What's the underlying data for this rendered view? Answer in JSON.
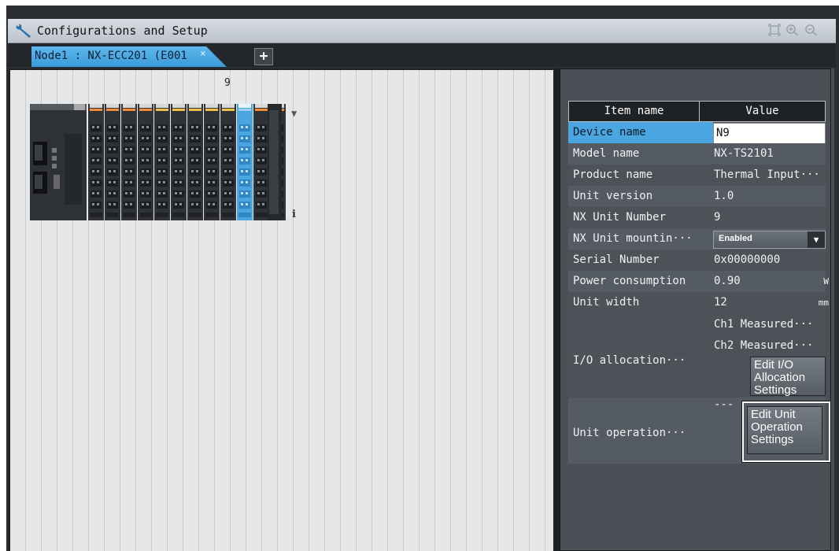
{
  "window": {
    "title": "Configurations and Setup",
    "toolbar_icons": [
      "fit-view-icon",
      "zoom-in-icon",
      "zoom-out-icon"
    ]
  },
  "tabs": [
    {
      "label": "Node1 : NX-ECC201 (E001",
      "close": "×"
    }
  ],
  "add_tab": "+",
  "canvas": {
    "slot_number": "9",
    "info_label": "i"
  },
  "properties": {
    "header": {
      "item": "Item name",
      "value": "Value"
    },
    "rows": [
      {
        "name": "Device name",
        "value": "N9"
      },
      {
        "name": "Model name",
        "value": "NX-TS2101"
      },
      {
        "name": "Product name",
        "value": "Thermal Input···"
      },
      {
        "name": "Unit version",
        "value": "1.0"
      },
      {
        "name": "NX Unit Number",
        "value": "9"
      },
      {
        "name": "NX Unit mountin···",
        "value": "Enabled"
      },
      {
        "name": "Serial Number",
        "value": "0x00000000"
      },
      {
        "name": "Power consumption",
        "value": "0.90",
        "unit": "W"
      },
      {
        "name": "Unit width",
        "value": "12",
        "unit": "mm"
      }
    ],
    "io_allocation": {
      "name": "I/O allocation···",
      "values": [
        "Ch1 Measured···",
        "Ch2 Measured···"
      ],
      "button": "Edit I/O Allocation Settings"
    },
    "unit_operation": {
      "name": "Unit operation···",
      "value": "---",
      "button": "Edit Unit Operation Settings"
    }
  },
  "colors": {
    "selection_blue": "#4aa6e0",
    "highlight_unit": "#4aa6e0"
  }
}
